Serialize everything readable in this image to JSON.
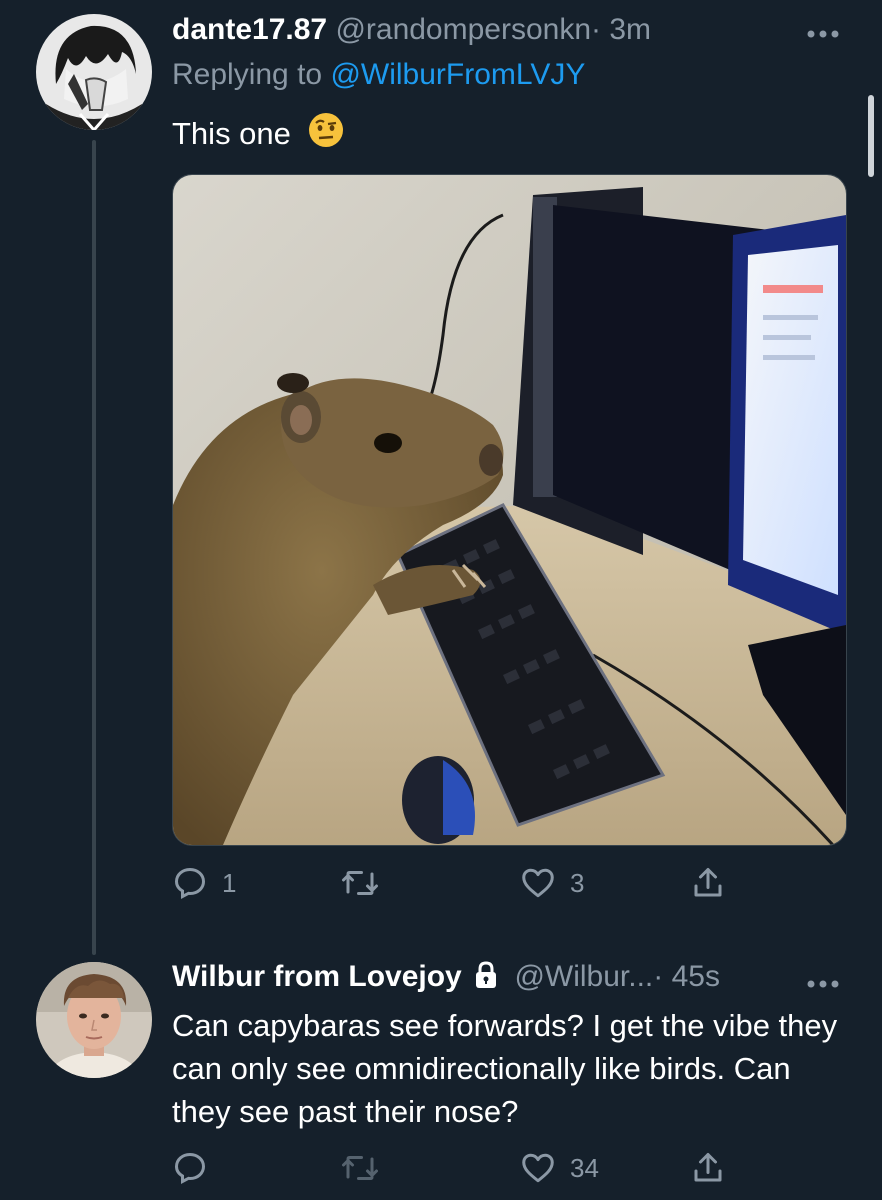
{
  "reply_tweet": {
    "display_name": "dante17.87",
    "handle": "@randompersonkn",
    "separator": "·",
    "time": "3m",
    "replying_prefix": "Replying to ",
    "replying_handle": "@WilburFromLVJY",
    "text": "This one",
    "emoji": "🤨",
    "actions": {
      "reply_count": "1",
      "retweet_count": "",
      "like_count": "3"
    },
    "icons": [
      "avatar",
      "more-icon",
      "reply-icon",
      "retweet-icon",
      "like-icon",
      "share-icon"
    ]
  },
  "original_tweet": {
    "display_name": "Wilbur from Lovejoy",
    "protected_icon": "lock-icon",
    "handle": "@Wilbur...",
    "separator": "·",
    "time": "45s",
    "text": "Can capybaras see forwards? I get the vibe they can only see omnidirectionally like birds. Can they see past their nose?",
    "actions": {
      "reply_count": "",
      "retweet_count": "",
      "like_count": "34"
    }
  },
  "colors": {
    "background": "#15202b",
    "muted": "#8b98a5",
    "link": "#1d9bf0",
    "thread_line": "#38444d"
  }
}
